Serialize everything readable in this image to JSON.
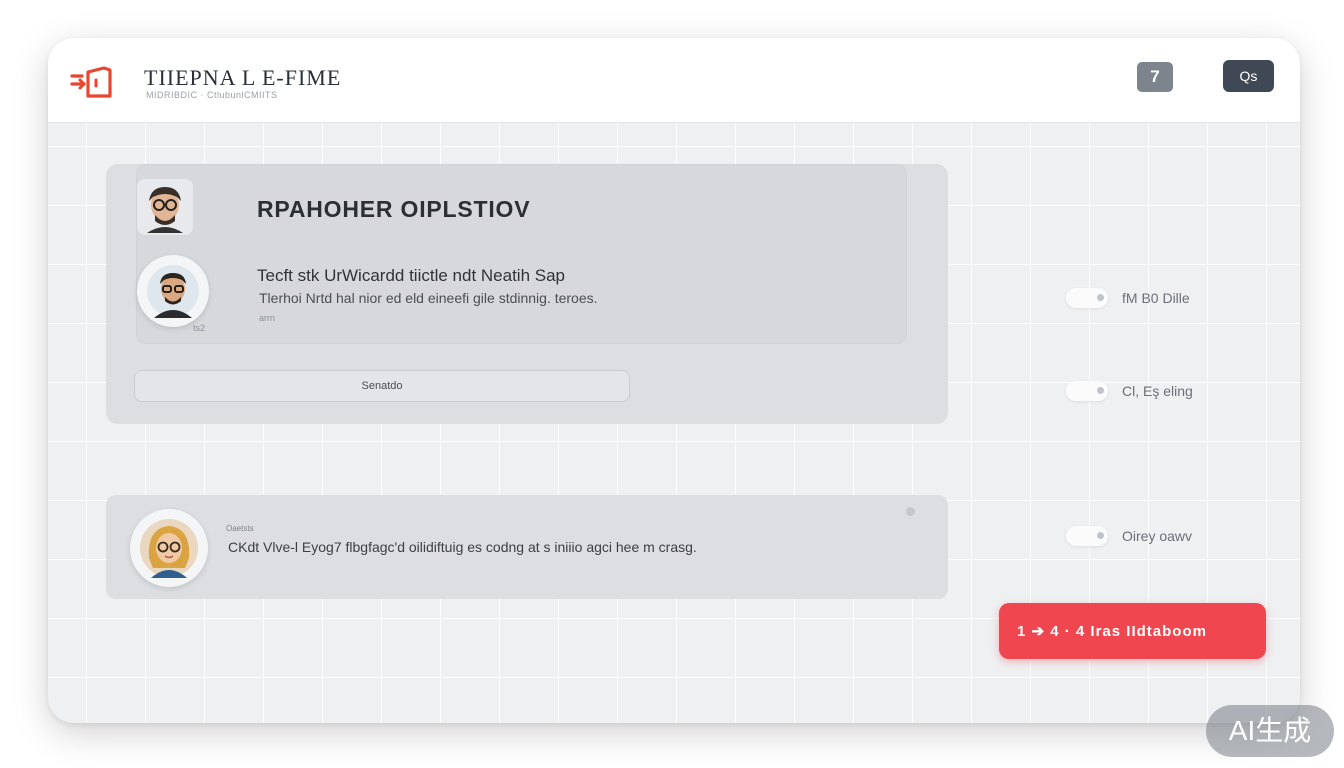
{
  "colors": {
    "accent": "#f0464f",
    "logo": "#e8462f",
    "header_dark_button": "#3f4854",
    "header_grey_button": "#7d848d"
  },
  "header": {
    "logo_icon": "exit-door-icon",
    "title": "TIIEPNA L E-FIME",
    "subtitle": "MIDRIBDIC · CtlubunlCMIITS",
    "grey_button_label": "7",
    "dark_button_label": "Qs"
  },
  "main_panel": {
    "title": "RPAHOHER OIPLSTIOV",
    "message": {
      "title": "Tecft stk UrWicardd tiictle ndt Neatih Sap",
      "body": "Tlerhoi Nrtd hal nior ed eld eineefi gile stdinnig. teroes.",
      "meta": "arrn",
      "avatar_caption": "ts2"
    },
    "search_placeholder": "Senatdo"
  },
  "second_panel": {
    "label": "Oaetsts",
    "body": "CKdt Vlve-l Eyog7 flbgfagc'd oilidiftuig es codng at s iniiio agci hee m crasg."
  },
  "settings": [
    {
      "label": "fM B0 Dille",
      "icon": "toggle-icon"
    },
    {
      "label": "Cl, Eş eling",
      "icon": "toggle-icon"
    },
    {
      "label": "Oirey oawv",
      "icon": "toggle-icon"
    }
  ],
  "cta_label": "1 ➔ 4 · 4 Iras IIdtaboom",
  "watermark": "AI生成"
}
